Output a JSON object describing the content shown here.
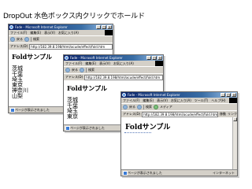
{
  "page": {
    "title": "DropOut 水色ボックス内クリックでホールド"
  },
  "browser": {
    "window_title": "Fade - Microsoft Internet Explorer",
    "menu": [
      "ファイル(F)",
      "編集(E)",
      "表示(V)",
      "お気に入り(A)",
      "ツール(T)",
      "ヘルプ(H)"
    ],
    "toolbar": {
      "back": "戻る",
      "search": "検索",
      "favorites": "お気に入り",
      "media": "メディア"
    },
    "address_label": "アドレス(D)",
    "address_value": "http://182.39.8.198/html/acude/effect/fold.htm",
    "go": "移動",
    "links": "リンク",
    "status_text": "ページが表示されました",
    "zone_text": "インターネット"
  },
  "windows": [
    {
      "heading": "Foldサンプル",
      "items": [
        "茨城",
        "千葉",
        "埼玉",
        "東京",
        "神奈川",
        "山梨"
      ]
    },
    {
      "heading": "Foldサンプル",
      "items": [
        "茨城",
        "千葉",
        "埼玉",
        "東京"
      ]
    },
    {
      "heading": "Foldサンプル",
      "items": []
    }
  ],
  "colors": {
    "titlebar": "#0a246a",
    "chrome": "#d4d0c8",
    "link_line": "#5a7ab8"
  }
}
